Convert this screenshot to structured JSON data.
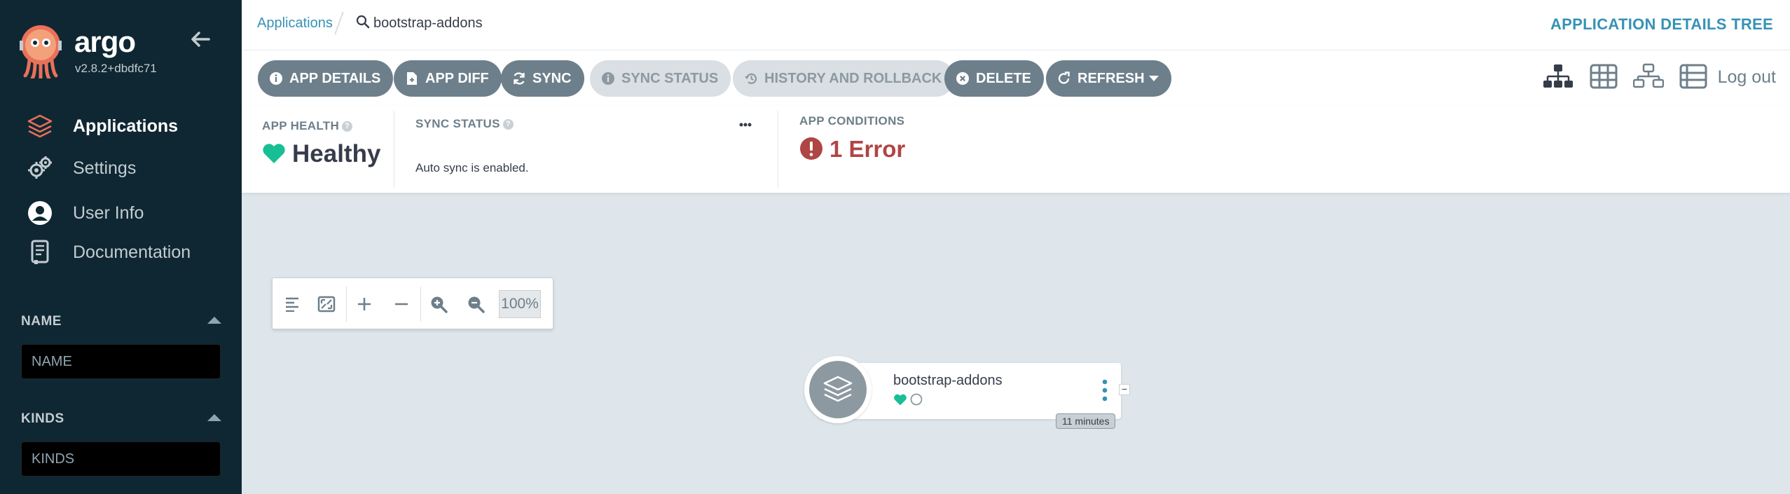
{
  "sidebar": {
    "brand": "argo",
    "version": "v2.8.2+dbdfc71",
    "nav": [
      {
        "label": "Applications",
        "icon": "layers-icon",
        "active": true
      },
      {
        "label": "Settings",
        "icon": "gears-icon",
        "active": false
      },
      {
        "label": "User Info",
        "icon": "user-circle-icon",
        "active": false
      },
      {
        "label": "Documentation",
        "icon": "book-icon",
        "active": false
      }
    ],
    "filters": [
      {
        "title": "NAME",
        "placeholder": "NAME"
      },
      {
        "title": "KINDS",
        "placeholder": "KINDS"
      }
    ]
  },
  "breadcrumb": {
    "root": "Applications",
    "current": "bootstrap-addons"
  },
  "view_title": "APPLICATION DETAILS TREE",
  "toolbar": {
    "buttons": [
      {
        "label": "APP DETAILS",
        "icon": "info-icon",
        "enabled": true
      },
      {
        "label": "APP DIFF",
        "icon": "file-icon",
        "enabled": true
      },
      {
        "label": "SYNC",
        "icon": "sync-icon",
        "enabled": true
      },
      {
        "label": "SYNC STATUS",
        "icon": "info-icon",
        "enabled": false
      },
      {
        "label": "HISTORY AND ROLLBACK",
        "icon": "history-icon",
        "enabled": false
      },
      {
        "label": "DELETE",
        "icon": "times-circle-icon",
        "enabled": true
      },
      {
        "label": "REFRESH",
        "icon": "redo-icon",
        "enabled": true
      }
    ],
    "view_icons": [
      "tree-view-icon",
      "pods-view-icon",
      "network-view-icon",
      "list-view-icon"
    ],
    "logout": "Log out"
  },
  "status": {
    "health_label": "APP HEALTH",
    "health_value": "Healthy",
    "sync_label": "SYNC STATUS",
    "sync_message": "Auto sync is enabled.",
    "conditions_label": "APP CONDITIONS",
    "conditions_value": "1 Error"
  },
  "zoom": {
    "level": "100%"
  },
  "node": {
    "name": "bootstrap-addons",
    "age": "11 minutes"
  },
  "colors": {
    "sidebar_bg": "#0f2733",
    "accent": "#3692b5",
    "healthy": "#18be94",
    "error": "#b04545",
    "button": "#6d7f8b"
  }
}
